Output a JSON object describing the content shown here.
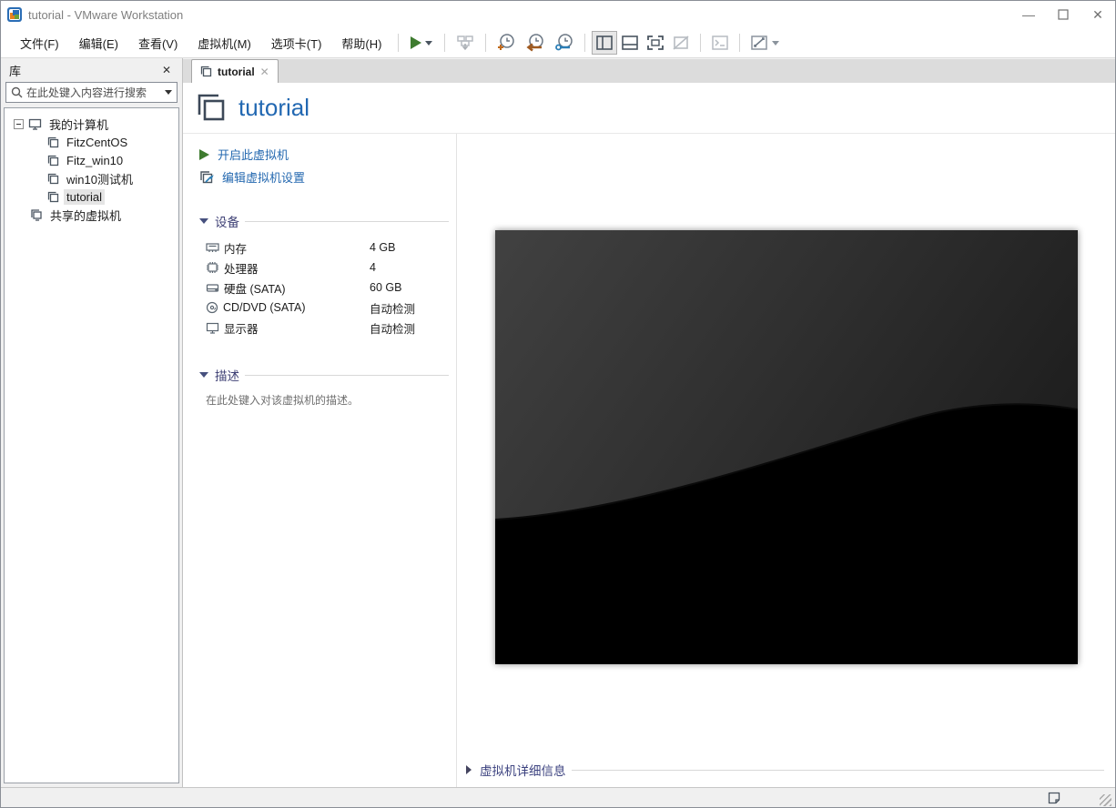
{
  "window": {
    "title": "tutorial - VMware Workstation"
  },
  "menus": [
    "文件(F)",
    "编辑(E)",
    "查看(V)",
    "虚拟机(M)",
    "选项卡(T)",
    "帮助(H)"
  ],
  "toolbar": {
    "icons": [
      "power-on-play",
      "power-on-caret",
      "send-ctrl-alt-del",
      "take-snapshot",
      "revert-snapshot",
      "manage-snapshots",
      "show-library",
      "show-console-view",
      "full-screen",
      "unity-mode",
      "open-terminal",
      "free-stretch",
      "free-stretch-caret"
    ]
  },
  "sidebar": {
    "header": "库",
    "search_placeholder": "在此处键入内容进行搜索",
    "tree": {
      "root": "我的计算机",
      "vms": [
        "FitzCentOS",
        "Fitz_win10",
        "win10测试机",
        "tutorial"
      ],
      "selected": "tutorial",
      "shared": "共享的虚拟机"
    }
  },
  "tab": {
    "label": "tutorial"
  },
  "vm": {
    "title": "tutorial",
    "commands": [
      {
        "label": "开启此虚拟机"
      },
      {
        "label": "编辑虚拟机设置"
      }
    ],
    "devices_header": "设备",
    "devices": [
      {
        "name": "内存",
        "value": "4 GB"
      },
      {
        "name": "处理器",
        "value": "4"
      },
      {
        "name": "硬盘 (SATA)",
        "value": "60 GB"
      },
      {
        "name": "CD/DVD (SATA)",
        "value": "自动检测"
      },
      {
        "name": "显示器",
        "value": "自动检测"
      }
    ],
    "description_header": "描述",
    "description_placeholder": "在此处键入对该虚拟机的描述。",
    "details_toggle": "虚拟机详细信息"
  },
  "colors": {
    "title_blue": "#2268b2",
    "link_blue": "#2569b0",
    "section_navy": "#3d3f74",
    "play_green": "#3e7b2f",
    "snapshot_orange": "#c06818",
    "snapshot_brown": "#a05a20",
    "snapshot_blue": "#2a7db5"
  }
}
